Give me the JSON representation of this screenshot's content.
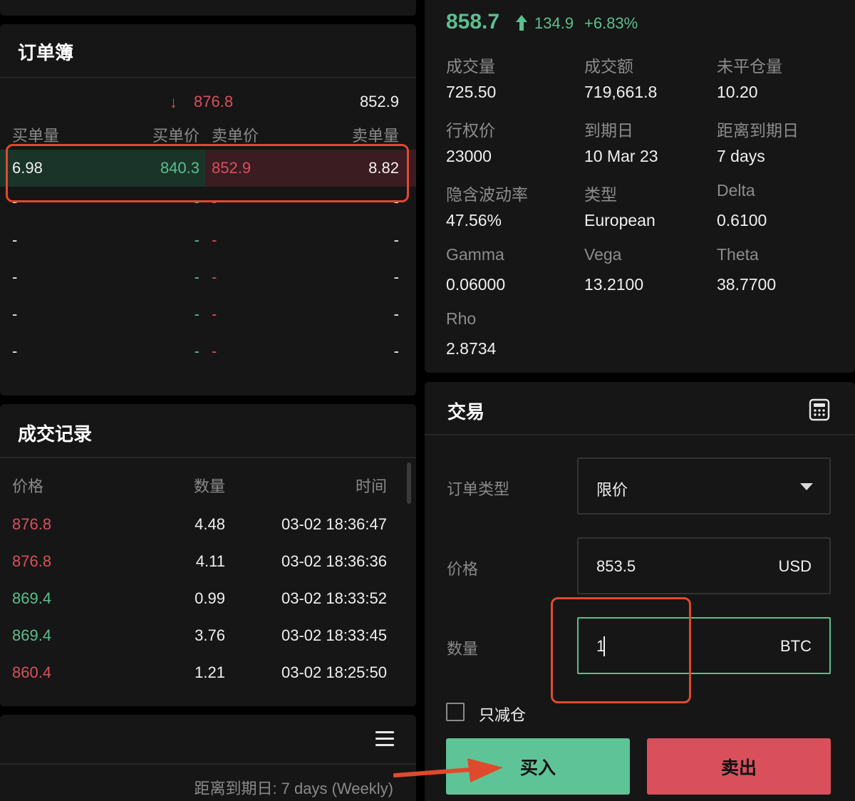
{
  "orderbook": {
    "title": "订单簿",
    "last_price": "876.8",
    "mark_price": "852.9",
    "headers": {
      "bid_qty": "买单量",
      "bid_price": "买单价",
      "ask_price": "卖单价",
      "ask_qty": "卖单量"
    },
    "rows": [
      {
        "bid_qty": "6.98",
        "bid_price": "840.3",
        "ask_price": "852.9",
        "ask_qty": "8.82"
      },
      {
        "bid_qty": "-",
        "bid_price": "-",
        "ask_price": "-",
        "ask_qty": "-"
      },
      {
        "bid_qty": "-",
        "bid_price": "-",
        "ask_price": "-",
        "ask_qty": "-"
      },
      {
        "bid_qty": "-",
        "bid_price": "-",
        "ask_price": "-",
        "ask_qty": "-"
      },
      {
        "bid_qty": "-",
        "bid_price": "-",
        "ask_price": "-",
        "ask_qty": "-"
      },
      {
        "bid_qty": "-",
        "bid_price": "-",
        "ask_price": "-",
        "ask_qty": "-"
      }
    ]
  },
  "trades": {
    "title": "成交记录",
    "headers": {
      "price": "价格",
      "qty": "数量",
      "time": "时间"
    },
    "rows": [
      {
        "price": "876.8",
        "qty": "4.48",
        "time": "03-02 18:36:47",
        "side": "sell"
      },
      {
        "price": "876.8",
        "qty": "4.11",
        "time": "03-02 18:36:36",
        "side": "sell"
      },
      {
        "price": "869.4",
        "qty": "0.99",
        "time": "03-02 18:33:52",
        "side": "buy"
      },
      {
        "price": "869.4",
        "qty": "3.76",
        "time": "03-02 18:33:45",
        "side": "buy"
      },
      {
        "price": "860.4",
        "qty": "1.21",
        "time": "03-02 18:25:50",
        "side": "sell"
      }
    ]
  },
  "footer": {
    "expiry_text": "距离到期日: 7 days (Weekly)"
  },
  "ticker": {
    "price": "858.7",
    "change": "134.9",
    "change_pct": "+6.83%",
    "stats": [
      {
        "label": "成交量",
        "value": "725.50"
      },
      {
        "label": "成交额",
        "value": "719,661.8"
      },
      {
        "label": "未平仓量",
        "value": "10.20"
      },
      {
        "label": "行权价",
        "value": "23000"
      },
      {
        "label": "到期日",
        "value": "10 Mar 23"
      },
      {
        "label": "距离到期日",
        "value": "7 days"
      },
      {
        "label": "隐含波动率",
        "value": "47.56%"
      },
      {
        "label": "类型",
        "value": "European"
      },
      {
        "label": "Delta",
        "value": "0.6100"
      },
      {
        "label": "Gamma",
        "value": "0.06000"
      },
      {
        "label": "Vega",
        "value": "13.2100"
      },
      {
        "label": "Theta",
        "value": "38.7700"
      },
      {
        "label": "Rho",
        "value": "2.8734"
      }
    ]
  },
  "trade_form": {
    "title": "交易",
    "order_type_label": "订单类型",
    "order_type_value": "限价",
    "price_label": "价格",
    "price_value": "853.5",
    "price_unit": "USD",
    "qty_label": "数量",
    "qty_value": "1",
    "qty_unit": "BTC",
    "reduce_only_label": "只减仓",
    "reduce_only_checked": false,
    "buy_label": "买入",
    "sell_label": "卖出"
  },
  "colors": {
    "green": "#5bbf8f",
    "red": "#d9505c",
    "buy_button": "#5ec498",
    "sell_button": "#d9505c",
    "annotation": "#e04a2c"
  }
}
